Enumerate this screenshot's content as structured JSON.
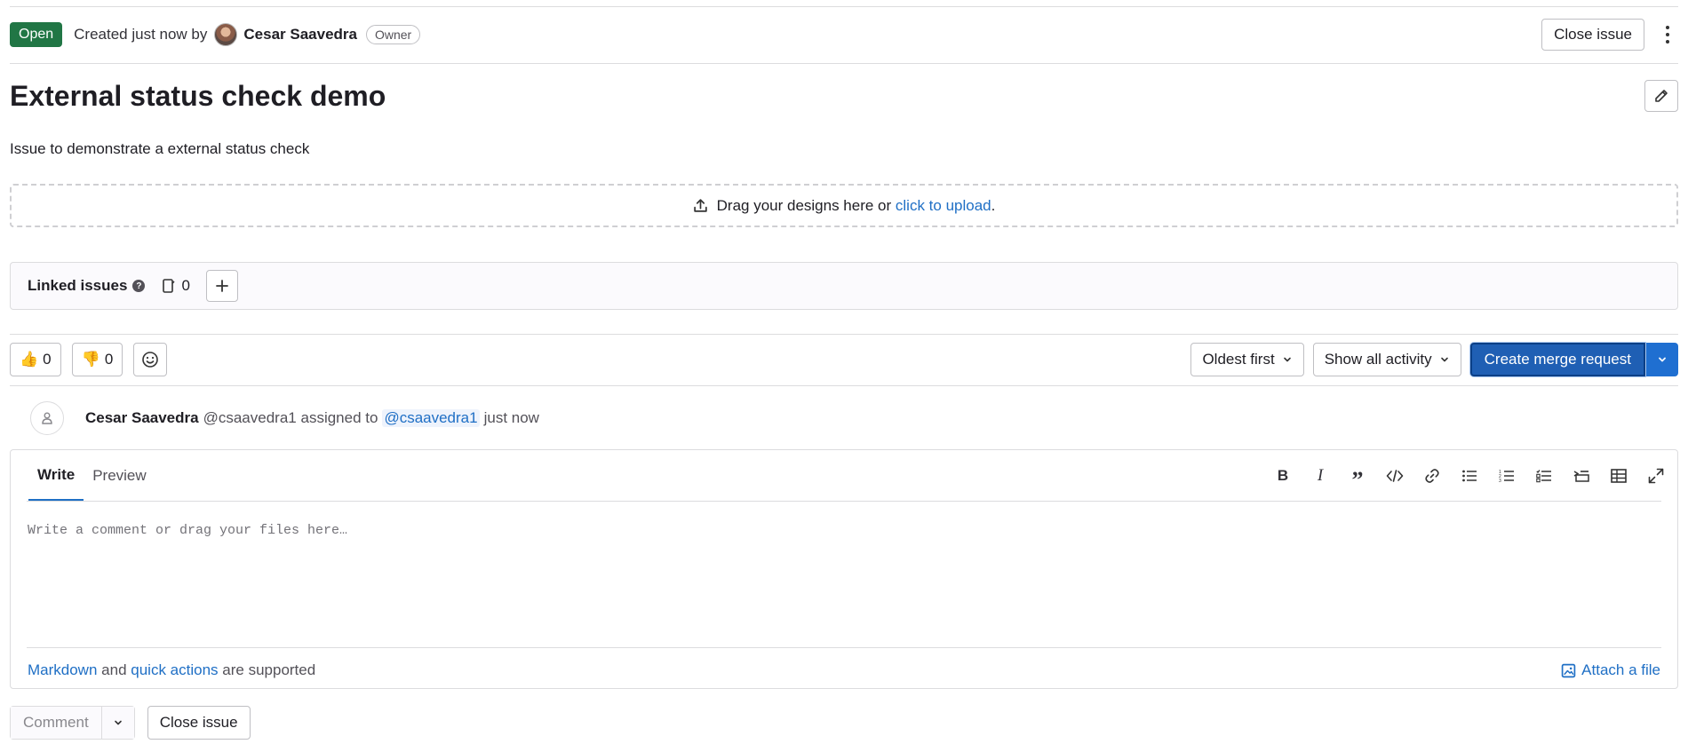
{
  "header": {
    "status": "Open",
    "created_text": "Created just now by",
    "author": "Cesar Saavedra",
    "role": "Owner",
    "close_label": "Close issue"
  },
  "issue": {
    "title": "External status check demo",
    "description": "Issue to demonstrate a external status check"
  },
  "designs": {
    "text": "Drag your designs here or",
    "link": "click to upload",
    "suffix": "."
  },
  "linked_issues": {
    "label": "Linked issues",
    "help": "?",
    "count": "0"
  },
  "reactions": {
    "thumbs_up_count": "0",
    "thumbs_down_count": "0"
  },
  "sort": {
    "order_label": "Oldest first",
    "filter_label": "Show all activity"
  },
  "merge_request": {
    "label": "Create merge request"
  },
  "activity": {
    "author": "Cesar Saavedra",
    "username": "@csaavedra1",
    "action": "assigned to",
    "mention": "@csaavedra1",
    "time": "just now"
  },
  "editor": {
    "tab_write": "Write",
    "tab_preview": "Preview",
    "placeholder": "Write a comment or drag your files here…",
    "markdown_link": "Markdown",
    "and_text": "and",
    "quick_actions_link": "quick actions",
    "supported_text": "are supported",
    "attach_label": "Attach a file"
  },
  "footer": {
    "comment_label": "Comment",
    "close_label": "Close issue"
  },
  "colors": {
    "open_badge": "#217645",
    "primary": "#1f5fb4",
    "link": "#1f6fc5"
  }
}
